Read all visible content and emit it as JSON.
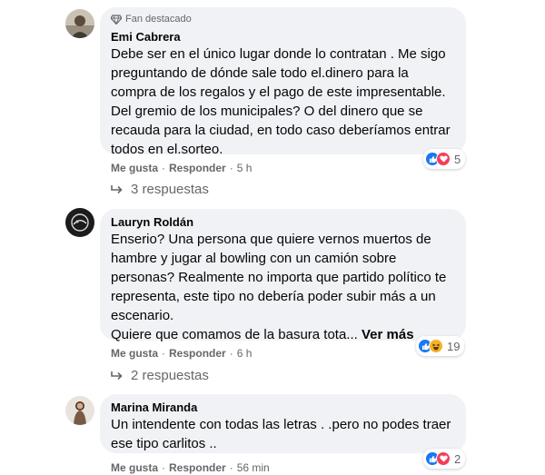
{
  "comments": [
    {
      "badge": "Fan destacado",
      "author": "Emi Cabrera",
      "lines": [
        "Debe ser en el único lugar donde lo contratan . Me sigo",
        "preguntando de dónde sale todo el.dinero para la",
        "compra de los regalos y el pago de este impresentable.",
        "Del gremio de los municipales? O del dinero que se",
        "recauda para la ciudad, en todo caso deberíamos entrar",
        "todos en el.sorteo."
      ],
      "like": "Me gusta",
      "reply": "Responder",
      "time": "5 h",
      "reaction_count": "5",
      "replies": "3 respuestas"
    },
    {
      "author": "Lauryn Roldán",
      "lines": [
        "Enserio? Una persona que quiere vernos muertos de",
        "hambre y jugar al bowling con un camión sobre",
        "personas? Realmente no importa que partido político te",
        "representa, este tipo no debería poder subir más a un",
        "escenario.",
        "Quiere que comamos de la basura tota..."
      ],
      "see_more": "Ver más",
      "like": "Me gusta",
      "reply": "Responder",
      "time": "6 h",
      "reaction_count": "19",
      "replies": "2 respuestas"
    },
    {
      "author": "Marina Miranda",
      "lines": [
        "Un intendente con todas las letras . .pero no podes traer",
        "ese tipo carlitos .."
      ],
      "like": "Me gusta",
      "reply": "Responder",
      "time": "56 min",
      "reaction_count": "2"
    }
  ],
  "colors": {
    "bubble": "#f0f2f5",
    "like_blue": "#1877f2",
    "love_red": "#f33e58",
    "haha_yellow": "#f7b125",
    "meta_gray": "#65676b"
  }
}
